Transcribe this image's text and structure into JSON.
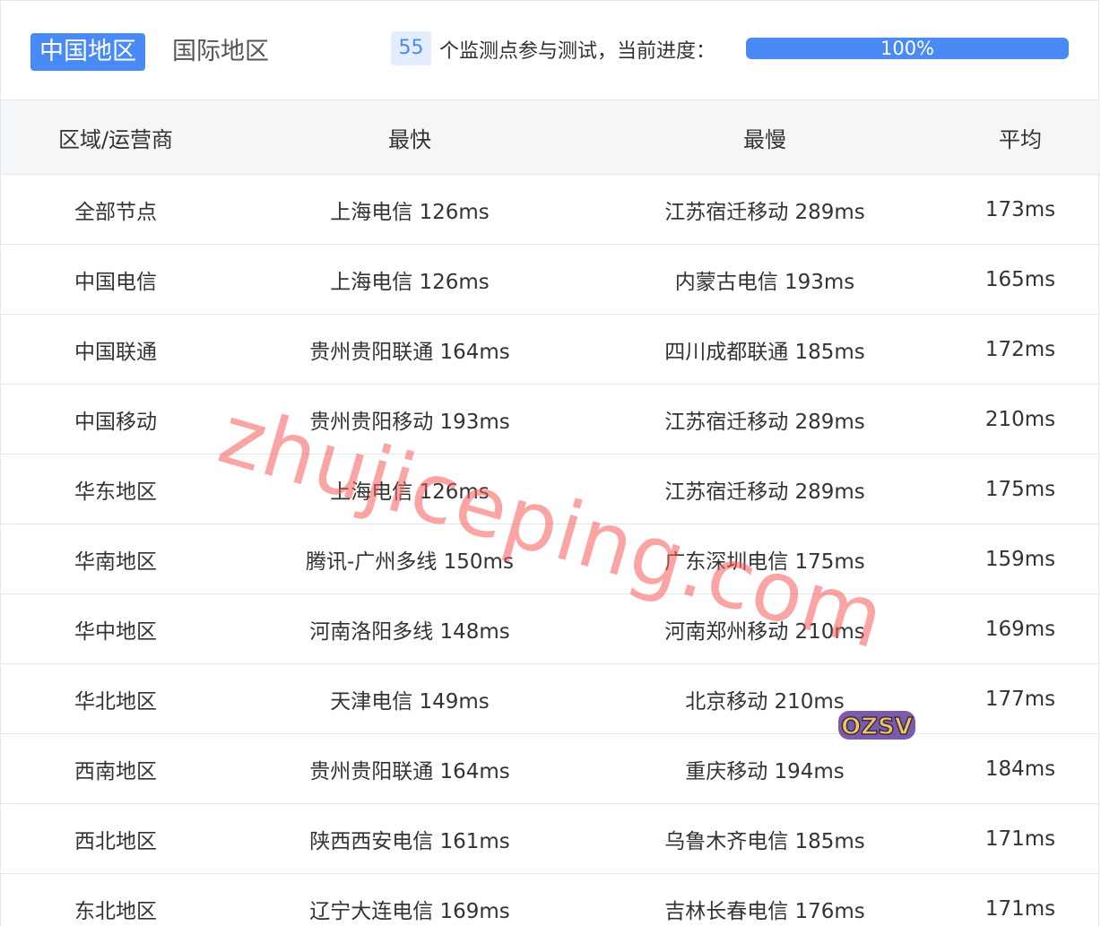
{
  "tabs": {
    "active": "中国地区",
    "inactive": "国际地区"
  },
  "progress": {
    "count": "55",
    "label": "个监测点参与测试，当前进度：",
    "value_text": "100%",
    "fraction": 1.0
  },
  "table": {
    "headers": {
      "region": "区域/运营商",
      "fastest": "最快",
      "slowest": "最慢",
      "average": "平均"
    },
    "rows": [
      {
        "region": "全部节点",
        "fastest": "上海电信 126ms",
        "slowest": "江苏宿迁移动 289ms",
        "average": "173ms"
      },
      {
        "region": "中国电信",
        "fastest": "上海电信 126ms",
        "slowest": "内蒙古电信 193ms",
        "average": "165ms"
      },
      {
        "region": "中国联通",
        "fastest": "贵州贵阳联通 164ms",
        "slowest": "四川成都联通 185ms",
        "average": "172ms"
      },
      {
        "region": "中国移动",
        "fastest": "贵州贵阳移动 193ms",
        "slowest": "江苏宿迁移动 289ms",
        "average": "210ms"
      },
      {
        "region": "华东地区",
        "fastest": "上海电信 126ms",
        "slowest": "江苏宿迁移动 289ms",
        "average": "175ms"
      },
      {
        "region": "华南地区",
        "fastest": "腾讯-广州多线 150ms",
        "slowest": "广东深圳电信 175ms",
        "average": "159ms"
      },
      {
        "region": "华中地区",
        "fastest": "河南洛阳多线 148ms",
        "slowest": "河南郑州移动 210ms",
        "average": "169ms"
      },
      {
        "region": "华北地区",
        "fastest": "天津电信 149ms",
        "slowest": "北京移动 210ms",
        "average": "177ms"
      },
      {
        "region": "西南地区",
        "fastest": "贵州贵阳联通 164ms",
        "slowest": "重庆移动 194ms",
        "average": "184ms"
      },
      {
        "region": "西北地区",
        "fastest": "陕西西安电信 161ms",
        "slowest": "乌鲁木齐电信 185ms",
        "average": "171ms"
      },
      {
        "region": "东北地区",
        "fastest": "辽宁大连电信 169ms",
        "slowest": "吉林长春电信 176ms",
        "average": "171ms"
      }
    ]
  },
  "watermark": {
    "text": "zhujiceping.com",
    "sticker_text": "OZSV"
  },
  "colors": {
    "accent": "#4a8af4",
    "accent_light": "#e4edff",
    "header_bg": "#f5f6f8",
    "border": "#e3e7ee",
    "watermark": "#f65a5a"
  }
}
